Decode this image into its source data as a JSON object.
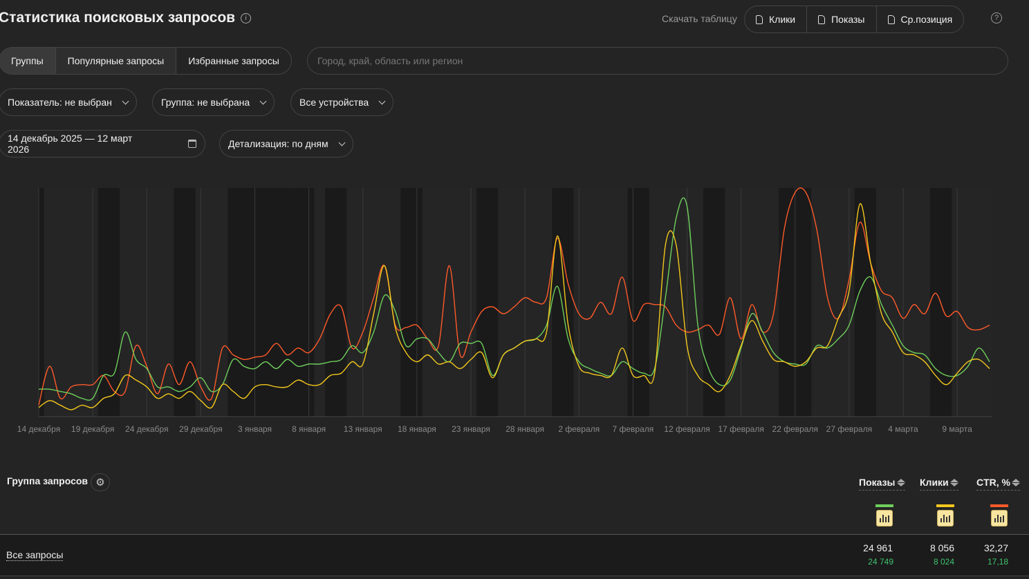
{
  "header": {
    "title": "Статистика поисковых запросов",
    "download_label": "Скачать таблицу",
    "download_buttons": [
      "Клики",
      "Показы",
      "Ср.позиция"
    ],
    "help": "?"
  },
  "tabs": [
    "Группы",
    "Популярные запросы",
    "Избранные запросы"
  ],
  "search": {
    "placeholder": "Город, край, область или регион",
    "value": ""
  },
  "filters": {
    "metric": "Показатель: не выбран",
    "group": "Группа: не выбрана",
    "devices": "Все устройства",
    "date_range": "14 декабрь 2025 — 12 март 2026",
    "detail": "Детализация: по дням"
  },
  "chart_data": {
    "type": "line",
    "start_date": "2025-12-14",
    "days": 89,
    "ylabel": "",
    "ylim": [
      0,
      100
    ],
    "note": "relative scale, no y-axis labels shown",
    "x_tick_labels": [
      "14 декабря",
      "19 декабря",
      "24 декабря",
      "29 декабря",
      "3 января",
      "8 января",
      "13 января",
      "18 января",
      "23 января",
      "28 января",
      "2 февраля",
      "7 февраля",
      "12 февраля",
      "17 февраля",
      "22 февраля",
      "27 февраля",
      "4 марта",
      "9 марта"
    ],
    "tick_every_days": 5,
    "shaded_days": [
      0,
      6,
      7,
      13,
      14,
      18,
      19,
      20,
      21,
      22,
      23,
      24,
      25,
      27,
      28,
      34,
      35,
      41,
      42,
      48,
      49,
      55,
      56,
      62,
      63,
      69,
      70,
      71,
      76,
      77,
      83,
      84
    ],
    "series": [
      {
        "name": "CTR, %",
        "color": "#ff5a2a",
        "values": [
          5,
          22,
          8,
          13,
          14,
          14,
          18,
          11,
          11,
          31,
          22,
          10,
          23,
          14,
          24,
          13,
          8,
          30,
          27,
          25,
          26,
          27,
          32,
          27,
          30,
          28,
          34,
          45,
          48,
          30,
          37,
          52,
          66,
          40,
          39,
          40,
          34,
          31,
          66,
          27,
          37,
          46,
          48,
          45,
          48,
          52,
          50,
          52,
          78,
          58,
          45,
          43,
          50,
          45,
          61,
          42,
          49,
          49,
          48,
          40,
          37,
          38,
          40,
          36,
          52,
          34,
          49,
          37,
          45,
          82,
          98,
          98,
          82,
          52,
          43,
          60,
          85,
          67,
          55,
          52,
          43,
          49,
          45,
          54,
          44,
          46,
          39,
          38,
          40
        ]
      },
      {
        "name": "Показы",
        "color": "#6fcf5c",
        "values": [
          12,
          12,
          11,
          10,
          8,
          8,
          18,
          19,
          37,
          25,
          21,
          13,
          13,
          11,
          13,
          17,
          11,
          14,
          25,
          22,
          21,
          24,
          21,
          25,
          22,
          23,
          23,
          24,
          25,
          31,
          28,
          37,
          53,
          46,
          31,
          34,
          34,
          28,
          24,
          32,
          32,
          32,
          18,
          27,
          30,
          33,
          34,
          40,
          57,
          34,
          24,
          21,
          19,
          18,
          24,
          21,
          19,
          21,
          52,
          87,
          92,
          40,
          21,
          14,
          16,
          30,
          45,
          37,
          28,
          24,
          23,
          23,
          31,
          30,
          34,
          40,
          55,
          61,
          49,
          40,
          31,
          28,
          27,
          21,
          18,
          18,
          22,
          30,
          24
        ]
      },
      {
        "name": "Клики",
        "color": "#f4c81c",
        "values": [
          4,
          7,
          5,
          3,
          5,
          4,
          8,
          10,
          18,
          16,
          13,
          8,
          10,
          8,
          11,
          7,
          4,
          14,
          11,
          8,
          13,
          14,
          13,
          13,
          16,
          14,
          14,
          18,
          19,
          24,
          23,
          45,
          66,
          39,
          28,
          24,
          27,
          23,
          24,
          21,
          25,
          28,
          17,
          27,
          30,
          33,
          34,
          37,
          79,
          40,
          22,
          19,
          18,
          18,
          30,
          18,
          18,
          19,
          75,
          75,
          31,
          18,
          14,
          11,
          18,
          31,
          42,
          33,
          25,
          24,
          22,
          24,
          30,
          31,
          43,
          55,
          93,
          67,
          45,
          37,
          28,
          27,
          24,
          18,
          14,
          19,
          24,
          25,
          21
        ]
      }
    ]
  },
  "table": {
    "group_header": "Группа запросов",
    "columns": [
      {
        "label": "Показы",
        "color": "#6fcf5c"
      },
      {
        "label": "Клики",
        "color": "#f4c81c"
      },
      {
        "label": "CTR, %",
        "color": "#ff5a2a"
      }
    ],
    "rows": [
      {
        "name": "Все запросы",
        "values": [
          "24 961",
          "8 056",
          "32,27"
        ],
        "secondary": [
          "24 749",
          "8 024",
          "17,18"
        ]
      }
    ]
  }
}
